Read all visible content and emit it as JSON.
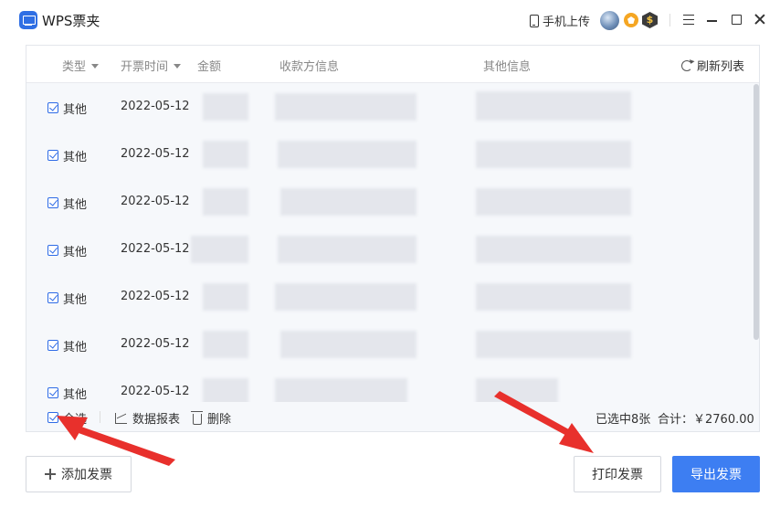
{
  "window": {
    "title": "WPS票夹",
    "mobile_upload_label": "手机上传"
  },
  "table": {
    "headers": {
      "type": "类型",
      "date": "开票时间",
      "amount": "金额",
      "payee": "收款方信息",
      "other": "其他信息"
    },
    "refresh_label": "刷新列表",
    "rows": [
      {
        "checked": true,
        "type": "其他",
        "date": "2022-05-12"
      },
      {
        "checked": true,
        "type": "其他",
        "date": "2022-05-12"
      },
      {
        "checked": true,
        "type": "其他",
        "date": "2022-05-12"
      },
      {
        "checked": true,
        "type": "其他",
        "date": "2022-05-12"
      },
      {
        "checked": true,
        "type": "其他",
        "date": "2022-05-12"
      },
      {
        "checked": true,
        "type": "其他",
        "date": "2022-05-12"
      },
      {
        "checked": true,
        "type": "其他",
        "date": "2022-05-12"
      }
    ]
  },
  "footer": {
    "select_all_label": "全选",
    "report_label": "数据报表",
    "delete_label": "删除",
    "selected_count": "已选中8张",
    "total": "合计：￥2760.00"
  },
  "actions": {
    "add_label": "添加发票",
    "print_label": "打印发票",
    "export_label": "导出发票"
  },
  "colors": {
    "primary": "#3d7ef2",
    "checkbox": "#2e6be6",
    "annotation_arrow": "#e8302c"
  }
}
